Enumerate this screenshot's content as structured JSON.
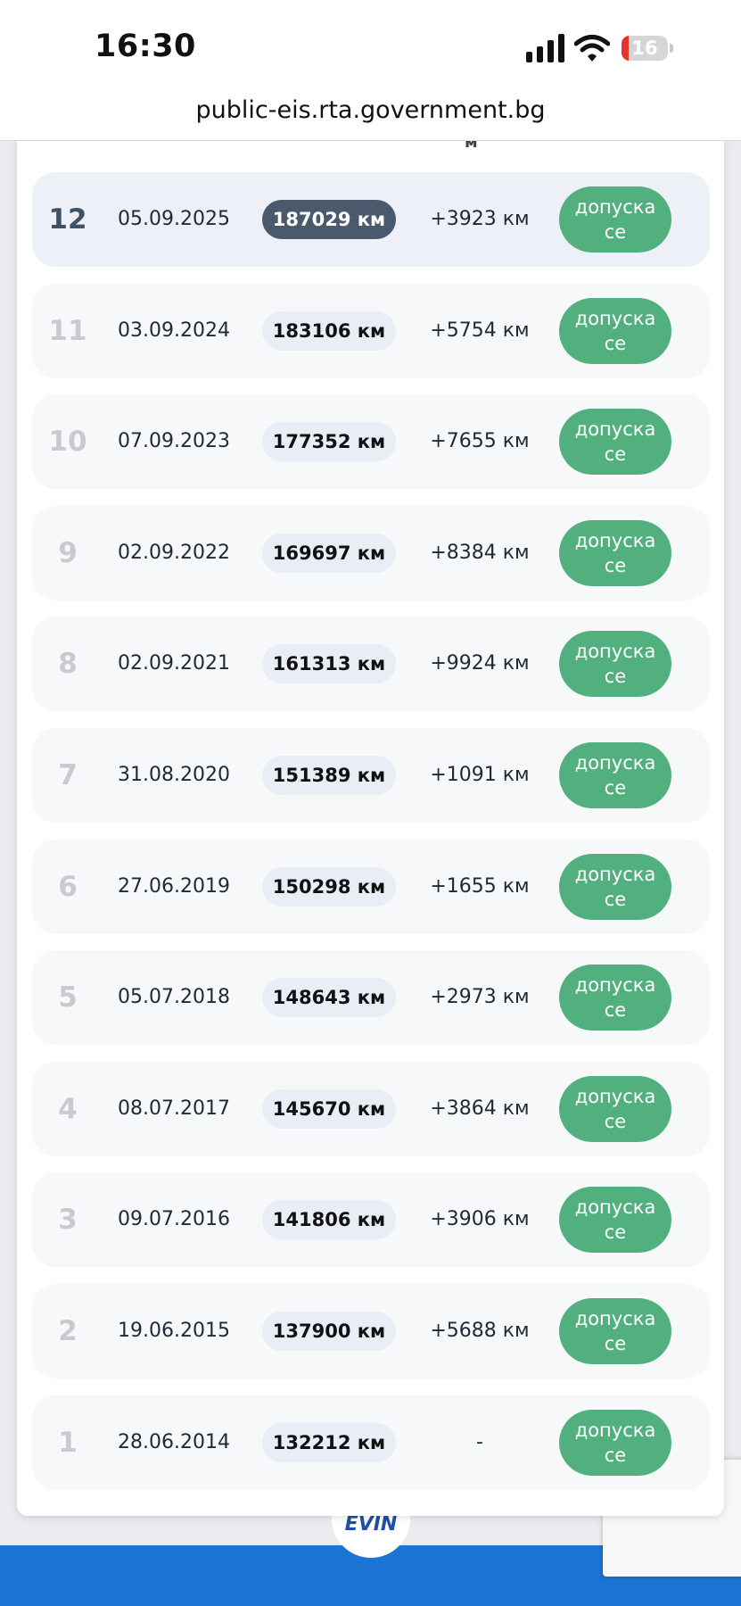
{
  "status_bar": {
    "time": "16:30",
    "battery_level": "16",
    "battery_fraction": 0.16
  },
  "browser": {
    "url": "public-eis.rta.government.bg"
  },
  "table": {
    "column_header_fragment": "м",
    "rows": [
      {
        "index": "12",
        "date": "05.09.2025",
        "mileage": "187029 км",
        "delta": "+3923 км",
        "status": "допуска се"
      },
      {
        "index": "11",
        "date": "03.09.2024",
        "mileage": "183106 км",
        "delta": "+5754 км",
        "status": "допуска се"
      },
      {
        "index": "10",
        "date": "07.09.2023",
        "mileage": "177352 км",
        "delta": "+7655 км",
        "status": "допуска се"
      },
      {
        "index": "9",
        "date": "02.09.2022",
        "mileage": "169697 км",
        "delta": "+8384 км",
        "status": "допуска се"
      },
      {
        "index": "8",
        "date": "02.09.2021",
        "mileage": "161313 км",
        "delta": "+9924 км",
        "status": "допуска се"
      },
      {
        "index": "7",
        "date": "31.08.2020",
        "mileage": "151389 км",
        "delta": "+1091 км",
        "status": "допуска се"
      },
      {
        "index": "6",
        "date": "27.06.2019",
        "mileage": "150298 км",
        "delta": "+1655 км",
        "status": "допуска се"
      },
      {
        "index": "5",
        "date": "05.07.2018",
        "mileage": "148643 км",
        "delta": "+2973 км",
        "status": "допуска се"
      },
      {
        "index": "4",
        "date": "08.07.2017",
        "mileage": "145670 км",
        "delta": "+3864 км",
        "status": "допуска се"
      },
      {
        "index": "3",
        "date": "09.07.2016",
        "mileage": "141806 км",
        "delta": "+3906 км",
        "status": "допуска се"
      },
      {
        "index": "2",
        "date": "19.06.2015",
        "mileage": "137900 км",
        "delta": "+5688 км",
        "status": "допуска се"
      },
      {
        "index": "1",
        "date": "28.06.2014",
        "mileage": "132212 км",
        "delta": "-",
        "status": "допуска се"
      }
    ]
  },
  "footer": {
    "logo_text": "EVIN"
  },
  "colors": {
    "status_green": "#52b07f",
    "latest_pill": "#4a5a6c",
    "footer_blue": "#1b73d3"
  }
}
